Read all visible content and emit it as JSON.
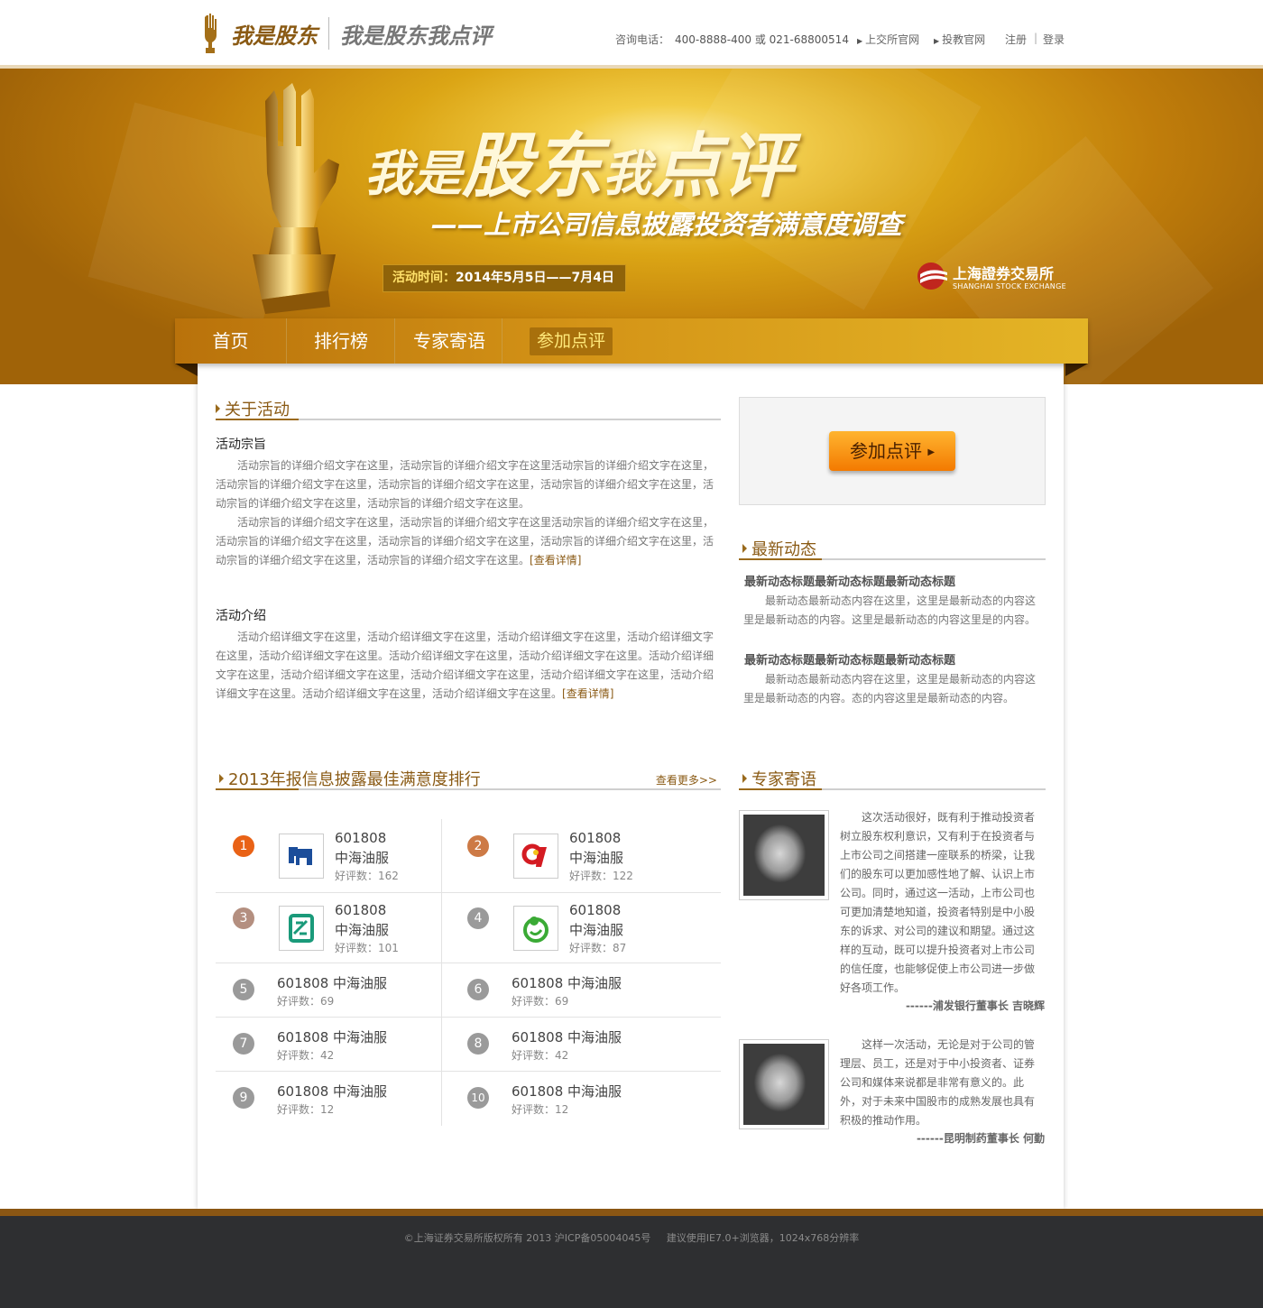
{
  "header": {
    "brand": "我是股东",
    "slogan": "我是股东我点评",
    "hotline_label": "咨询电话：",
    "hotline": "400-8888-400 或 021-68800514",
    "links": [
      "上交所官网",
      "投教官网"
    ],
    "register": "注册",
    "separator": "|",
    "login": "登录"
  },
  "banner": {
    "title_a": "我是",
    "title_b": "股东",
    "title_c": "我",
    "title_d": "点评",
    "subtitle": "——上市公司信息披露投资者满意度调查",
    "time_label": "活动时间：",
    "time_value": "2014年5月5日——7月4日",
    "exchange_cn": "上海證券交易所",
    "exchange_en": "SHANGHAI STOCK EXCHANGE"
  },
  "nav": {
    "items": [
      "首页",
      "排行榜",
      "专家寄语",
      "参加点评"
    ]
  },
  "about": {
    "title": "关于活动",
    "purpose_title": "活动宗旨",
    "purpose_p1": "活动宗旨的详细介绍文字在这里，活动宗旨的详细介绍文字在这里活动宗旨的详细介绍文字在这里，活动宗旨的详细介绍文字在这里，活动宗旨的详细介绍文字在这里，活动宗旨的详细介绍文字在这里，活动宗旨的详细介绍文字在这里，活动宗旨的详细介绍文字在这里。",
    "purpose_p2": "活动宗旨的详细介绍文字在这里，活动宗旨的详细介绍文字在这里活动宗旨的详细介绍文字在这里，活动宗旨的详细介绍文字在这里，活动宗旨的详细介绍文字在这里，活动宗旨的详细介绍文字在这里，活动宗旨的详细介绍文字在这里，活动宗旨的详细介绍文字在这里。",
    "intro_title": "活动介绍",
    "intro_p": "活动介绍详细文字在这里，活动介绍详细文字在这里，活动介绍详细文字在这里，活动介绍详细文字在这里，活动介绍详细文字在这里。活动介绍详细文字在这里，活动介绍详细文字在这里。活动介绍详细文字在这里，活动介绍详细文字在这里，活动介绍详细文字在这里，活动介绍详细文字在这里，活动介绍详细文字在这里。活动介绍详细文字在这里，活动介绍详细文字在这里。",
    "detail_link": "[查看详情]"
  },
  "cta": {
    "label": "参加点评"
  },
  "news": {
    "title": "最新动态",
    "items": [
      {
        "title": "最新动态标题最新动态标题最新动态标题",
        "body": "最新动态最新动态内容在这里，这里是最新动态的内容这里是最新动态的内容。这里是最新动态的内容这里是的内容。"
      },
      {
        "title": "最新动态标题最新动态标题最新动态标题",
        "body": "最新动态最新动态内容在这里，这里是最新动态的内容这里是最新动态的内容。态的内容这里是最新动态的内容。"
      }
    ]
  },
  "ranking": {
    "title": "2013年报信息披露最佳满意度排行",
    "more": "查看更多>>",
    "good_label": "好评数：",
    "rows": [
      {
        "rank": "1",
        "code": "601808",
        "name": "中海油服",
        "count": "162"
      },
      {
        "rank": "2",
        "code": "601808",
        "name": "中海油服",
        "count": "122"
      },
      {
        "rank": "3",
        "code": "601808",
        "name": "中海油服",
        "count": "101"
      },
      {
        "rank": "4",
        "code": "601808",
        "name": "中海油服",
        "count": "87"
      },
      {
        "rank": "5",
        "code": "601808",
        "name": "中海油服",
        "count": "69"
      },
      {
        "rank": "6",
        "code": "601808",
        "name": "中海油服",
        "count": "69"
      },
      {
        "rank": "7",
        "code": "601808",
        "name": "中海油服",
        "count": "42"
      },
      {
        "rank": "8",
        "code": "601808",
        "name": "中海油服",
        "count": "42"
      },
      {
        "rank": "9",
        "code": "601808",
        "name": "中海油服",
        "count": "12"
      },
      {
        "rank": "10",
        "code": "601808",
        "name": "中海油服",
        "count": "12"
      }
    ],
    "badge_colors": [
      "#e96216",
      "#cd7a46",
      "#b48f80",
      "#9a9a9a"
    ]
  },
  "experts": {
    "title": "专家寄语",
    "items": [
      {
        "quote": "这次活动很好，既有利于推动投资者树立股东权利意识，又有利于在投资者与上市公司之间搭建一座联系的桥梁，让我们的股东可以更加感性地了解、认识上市公司。同时，通过这一活动，上市公司也可更加清楚地知道，投资者特别是中小股东的诉求、对公司的建议和期望。通过这样的互动，既可以提升投资者对上市公司的信任度，也能够促使上市公司进一步做好各项工作。",
        "sign": "------浦发银行董事长 吉晓辉"
      },
      {
        "quote": "这样一次活动，无论是对于公司的管理层、员工，还是对于中小投资者、证券公司和媒体来说都是非常有意义的。此外，对于未来中国股市的成熟发展也具有积极的推动作用。",
        "sign": "------昆明制药董事长 何勤"
      }
    ]
  },
  "footer": {
    "copyright": "©上海证券交易所版权所有 2013 沪ICP备05004045号",
    "browser": "建议使用IE7.0+浏览器，1024x768分辨率"
  }
}
